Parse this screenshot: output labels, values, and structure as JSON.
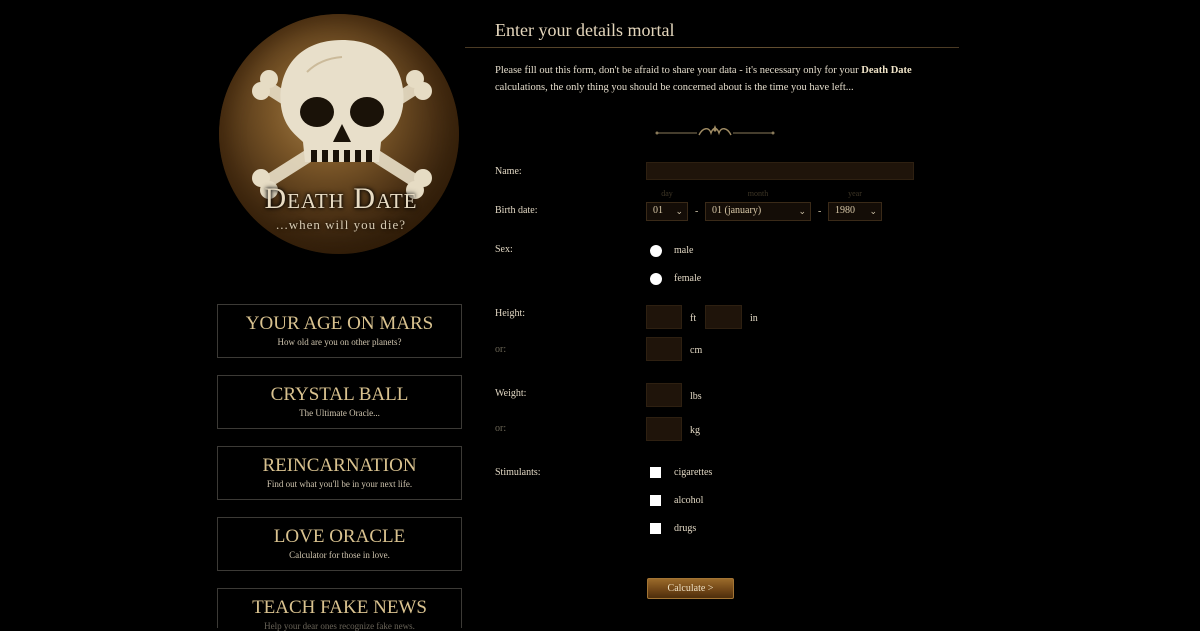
{
  "logo": {
    "title": "Death Date",
    "subtitle": "...when will you die?"
  },
  "promos": [
    {
      "title": "YOUR AGE ON MARS",
      "subtitle": "How old are you on other planets?"
    },
    {
      "title": "CRYSTAL BALL",
      "subtitle": "The Ultimate Oracle..."
    },
    {
      "title": "REINCARNATION",
      "subtitle": "Find out what you'll be in your next life."
    },
    {
      "title": "LOVE ORACLE",
      "subtitle": "Calculator for those in love."
    },
    {
      "title": "TEACH FAKE NEWS",
      "subtitle": "Help your dear ones recognize fake news."
    }
  ],
  "form": {
    "heading": "Enter your details mortal",
    "intro_before": "Please fill out this form, don't be afraid to share your data - it's necessary only for your ",
    "intro_bold": "Death Date",
    "intro_after": " calculations, the only thing you should be concerned about is the time you have left...",
    "name_label": "Name:",
    "name_value": "",
    "birth_label": "Birth date:",
    "day_hint": "day",
    "month_hint": "month",
    "year_hint": "year",
    "day_value": "01",
    "month_value": "01 (january)",
    "year_value": "1980",
    "date_separator": "-",
    "sex_label": "Sex:",
    "sex_male": "male",
    "sex_female": "female",
    "height_label": "Height:",
    "or_label": "or:",
    "unit_ft": "ft",
    "unit_in": "in",
    "unit_cm": "cm",
    "weight_label": "Weight:",
    "unit_lbs": "lbs",
    "unit_kg": "kg",
    "stimulants_label": "Stimulants:",
    "stim_cigarettes": "cigarettes",
    "stim_alcohol": "alcohol",
    "stim_drugs": "drugs",
    "submit_label": "Calculate >"
  },
  "icons": {
    "chevron": "chevron-down-icon",
    "skull": "skull-icon",
    "ornament": "ornament-icon"
  },
  "colors": {
    "background": "#000000",
    "accent": "#d9c28f",
    "button": "#7a4a18",
    "input": "#1f140a"
  }
}
